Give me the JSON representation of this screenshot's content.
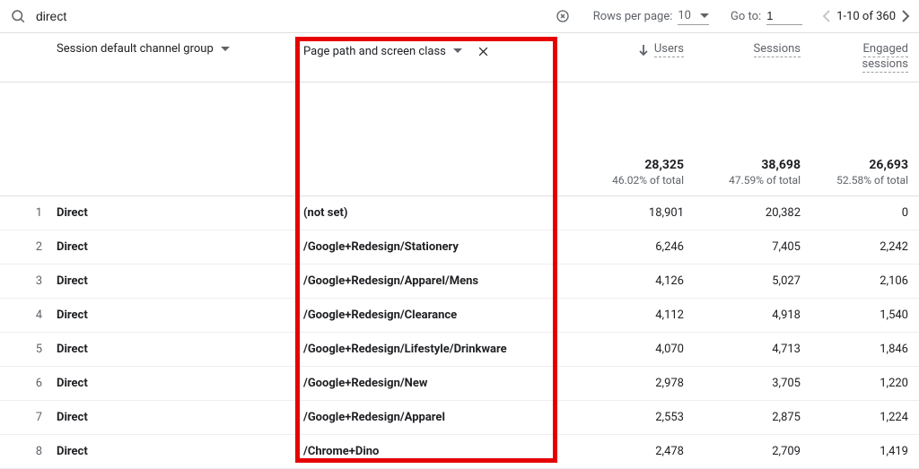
{
  "search": {
    "value": "direct"
  },
  "pagination": {
    "rowsPerPageLabel": "Rows per page:",
    "rowsPerPage": "10",
    "goToLabel": "Go to:",
    "goToValue": "1",
    "rangeLabel": "1-10 of 360"
  },
  "columns": {
    "dim1": "Session default channel group",
    "dim2": "Page path and screen class",
    "m1": "Users",
    "m2": "Sessions",
    "m3_line1": "Engaged",
    "m3_line2": "sessions"
  },
  "summary": {
    "users": {
      "value": "28,325",
      "pct": "46.02% of total"
    },
    "sessions": {
      "value": "38,698",
      "pct": "47.59% of total"
    },
    "engaged": {
      "value": "26,693",
      "pct": "52.58% of total"
    }
  },
  "rows": [
    {
      "idx": "1",
      "channel": "Direct",
      "page": "(not set)",
      "users": "18,901",
      "sessions": "20,382",
      "engaged": "0"
    },
    {
      "idx": "2",
      "channel": "Direct",
      "page": "/Google+Redesign/Stationery",
      "users": "6,246",
      "sessions": "7,405",
      "engaged": "2,242"
    },
    {
      "idx": "3",
      "channel": "Direct",
      "page": "/Google+Redesign/Apparel/Mens",
      "users": "4,126",
      "sessions": "5,027",
      "engaged": "2,106"
    },
    {
      "idx": "4",
      "channel": "Direct",
      "page": "/Google+Redesign/Clearance",
      "users": "4,112",
      "sessions": "4,918",
      "engaged": "1,540"
    },
    {
      "idx": "5",
      "channel": "Direct",
      "page": "/Google+Redesign/Lifestyle/Drinkware",
      "users": "4,070",
      "sessions": "4,713",
      "engaged": "1,846"
    },
    {
      "idx": "6",
      "channel": "Direct",
      "page": "/Google+Redesign/New",
      "users": "2,978",
      "sessions": "3,705",
      "engaged": "1,220"
    },
    {
      "idx": "7",
      "channel": "Direct",
      "page": "/Google+Redesign/Apparel",
      "users": "2,553",
      "sessions": "2,875",
      "engaged": "1,224"
    },
    {
      "idx": "8",
      "channel": "Direct",
      "page": "/Chrome+Dino",
      "users": "2,478",
      "sessions": "2,709",
      "engaged": "1,419"
    }
  ]
}
